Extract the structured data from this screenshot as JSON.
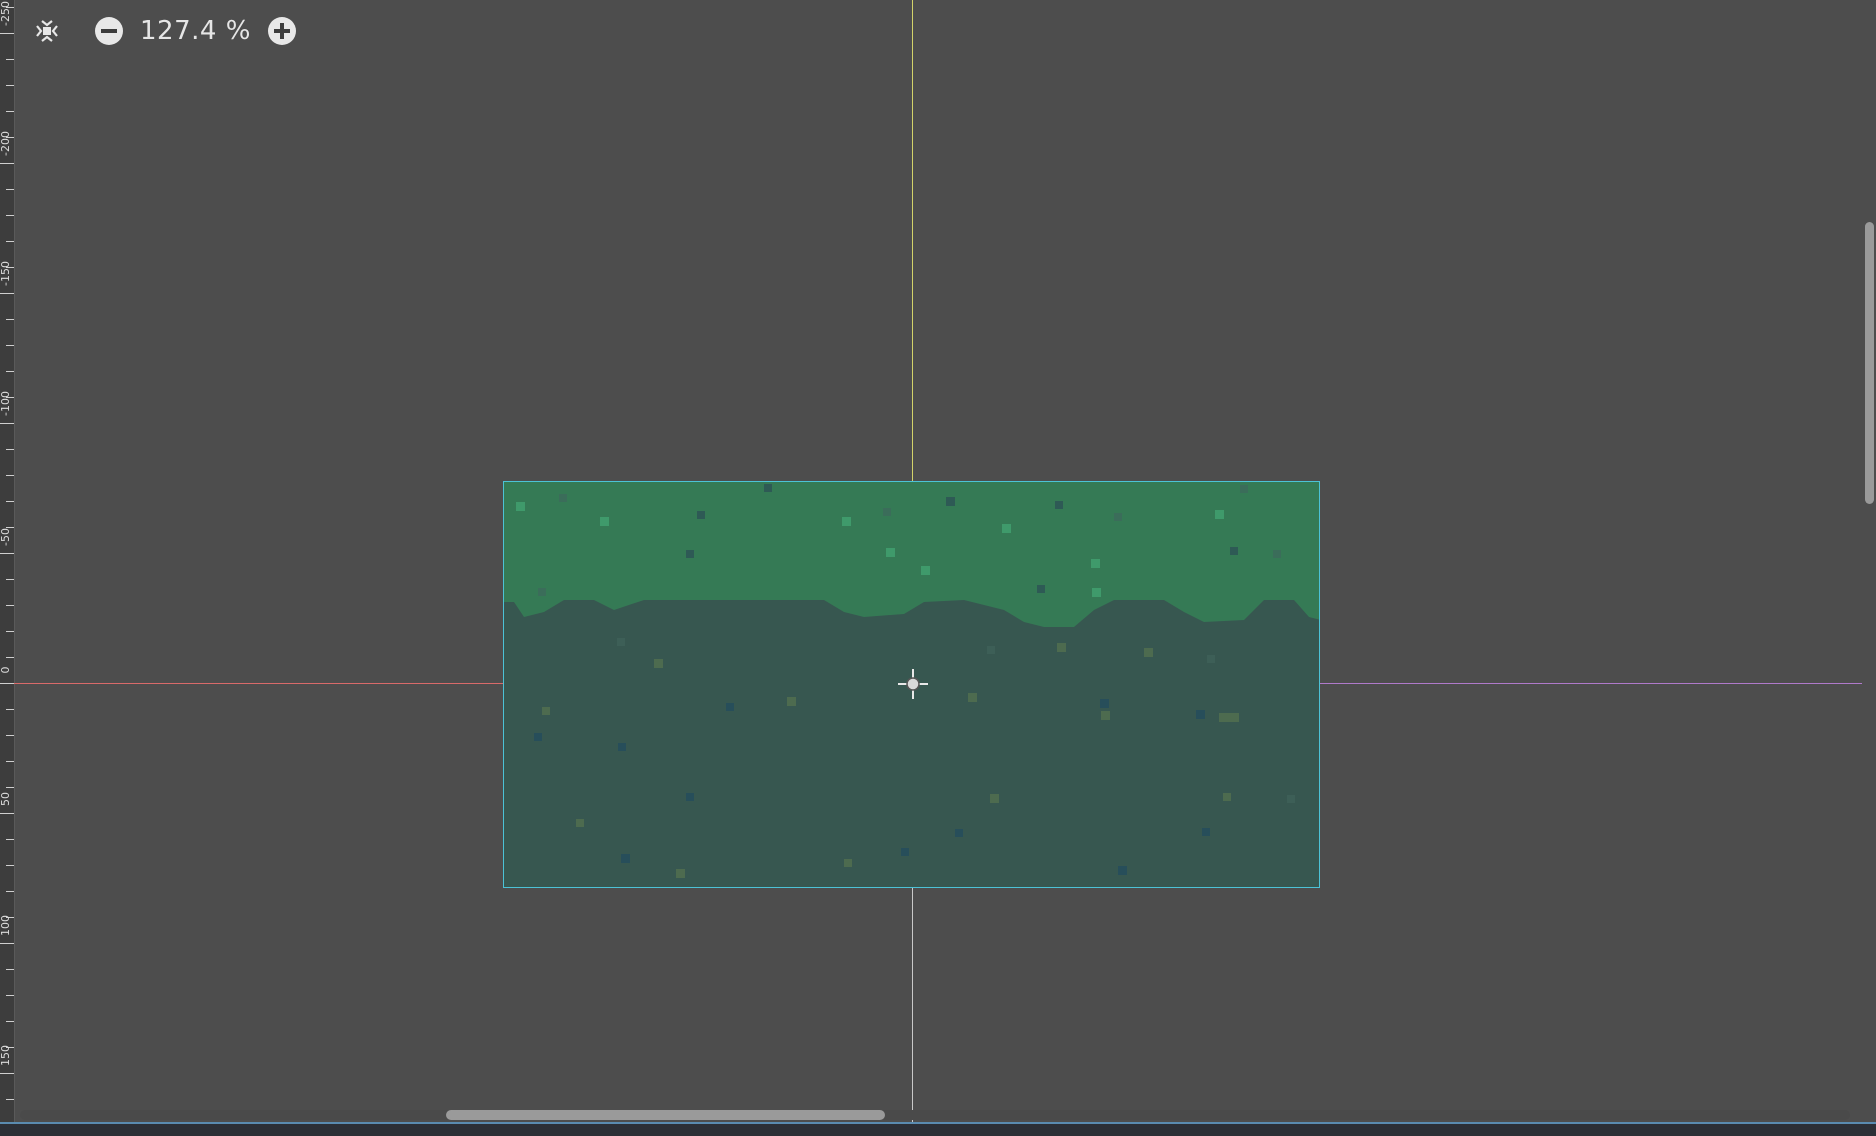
{
  "toolbar": {
    "center_view_icon": "center-view-icon",
    "zoom_out_icon": "zoom-out-icon",
    "zoom_label": "127.4 %",
    "zoom_in_icon": "zoom-in-icon"
  },
  "ruler": {
    "labels": [
      "-250",
      "-200",
      "-150",
      "-100",
      "-50",
      "0",
      "50",
      "100",
      "150"
    ]
  },
  "colors": {
    "canvas_bg": "#4d4d4d",
    "tile_top": "#357a55",
    "tile_bottom": "#375750",
    "tile_border": "#4cc2d6",
    "x_axis": "#d96a6a",
    "y_axis": "#d3d36a",
    "guide": "#b07acb"
  },
  "scroll": {
    "vertical_thumb_fraction": 0.25,
    "horizontal_thumb_fraction": 0.24
  }
}
